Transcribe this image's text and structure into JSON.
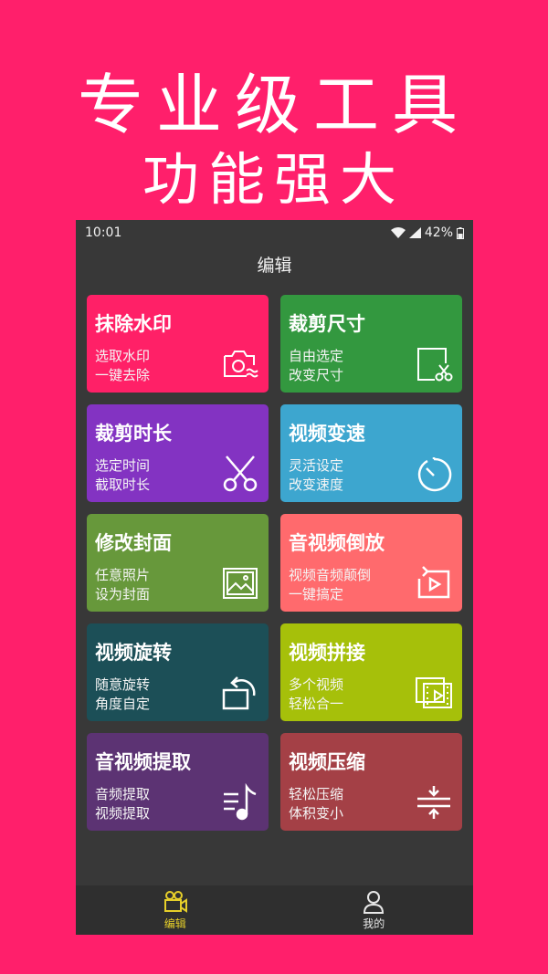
{
  "promo": {
    "line1": "专业级工具",
    "line2": "功能强大"
  },
  "status": {
    "time": "10:01",
    "battery": "42%"
  },
  "appbar": {
    "title": "编辑"
  },
  "tiles": [
    {
      "title": "抹除水印",
      "sub1": "选取水印",
      "sub2": "一键去除",
      "color": "#ff2067",
      "icon": "camera-wave-icon"
    },
    {
      "title": "裁剪尺寸",
      "sub1": "自由选定",
      "sub2": "改变尺寸",
      "color": "#33983f",
      "icon": "crop-scissors-icon"
    },
    {
      "title": "裁剪时长",
      "sub1": "选定时间",
      "sub2": "截取时长",
      "color": "#8333c2",
      "icon": "scissors-icon"
    },
    {
      "title": "视频变速",
      "sub1": "灵活设定",
      "sub2": "改变速度",
      "color": "#3da6cf",
      "icon": "timer-icon"
    },
    {
      "title": "修改封面",
      "sub1": "任意照片",
      "sub2": "设为封面",
      "color": "#67983b",
      "icon": "image-icon"
    },
    {
      "title": "音视频倒放",
      "sub1": "视频音频颠倒",
      "sub2": "一键搞定",
      "color": "#ff6a6d",
      "icon": "reverse-play-icon"
    },
    {
      "title": "视频旋转",
      "sub1": "随意旋转",
      "sub2": "角度自定",
      "color": "#1c4f57",
      "icon": "rotate-icon"
    },
    {
      "title": "视频拼接",
      "sub1": "多个视频",
      "sub2": "轻松合一",
      "color": "#a6c00a",
      "icon": "video-stack-icon"
    },
    {
      "title": "音视频提取",
      "sub1": "音频提取",
      "sub2": "视频提取",
      "color": "#5c3373",
      "icon": "music-list-icon"
    },
    {
      "title": "视频压缩",
      "sub1": "轻松压缩",
      "sub2": "体积变小",
      "color": "#a44046",
      "icon": "compress-icon"
    }
  ],
  "nav": {
    "edit_label": "编辑",
    "mine_label": "我的",
    "active_color": "#e6cf2a"
  }
}
